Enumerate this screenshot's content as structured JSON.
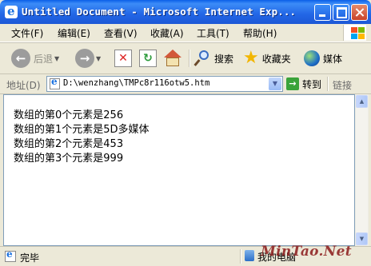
{
  "window": {
    "title": "Untitled Document - Microsoft Internet Exp..."
  },
  "menu": {
    "items": [
      {
        "label": "文件(F)"
      },
      {
        "label": "编辑(E)"
      },
      {
        "label": "查看(V)"
      },
      {
        "label": "收藏(A)"
      },
      {
        "label": "工具(T)"
      },
      {
        "label": "帮助(H)"
      }
    ]
  },
  "toolbar": {
    "back_label": "后退",
    "search_label": "搜索",
    "favorites_label": "收藏夹",
    "media_label": "媒体"
  },
  "address": {
    "label": "地址(D)",
    "value": "D:\\wenzhang\\TMPc8r116otw5.htm",
    "go_label": "转到",
    "links_label": "链接"
  },
  "content": {
    "lines": [
      "数组的第0个元素是256",
      "数组的第1个元素是5D多媒体",
      "数组的第2个元素是453",
      "数组的第3个元素是999"
    ]
  },
  "status": {
    "text": "完毕",
    "zone": "我的电脑"
  },
  "watermark": "MinTao.Net",
  "colors": {
    "titlebar": "#2266E6",
    "chrome": "#ECE9D8",
    "watermark": "#8B1A1A"
  }
}
